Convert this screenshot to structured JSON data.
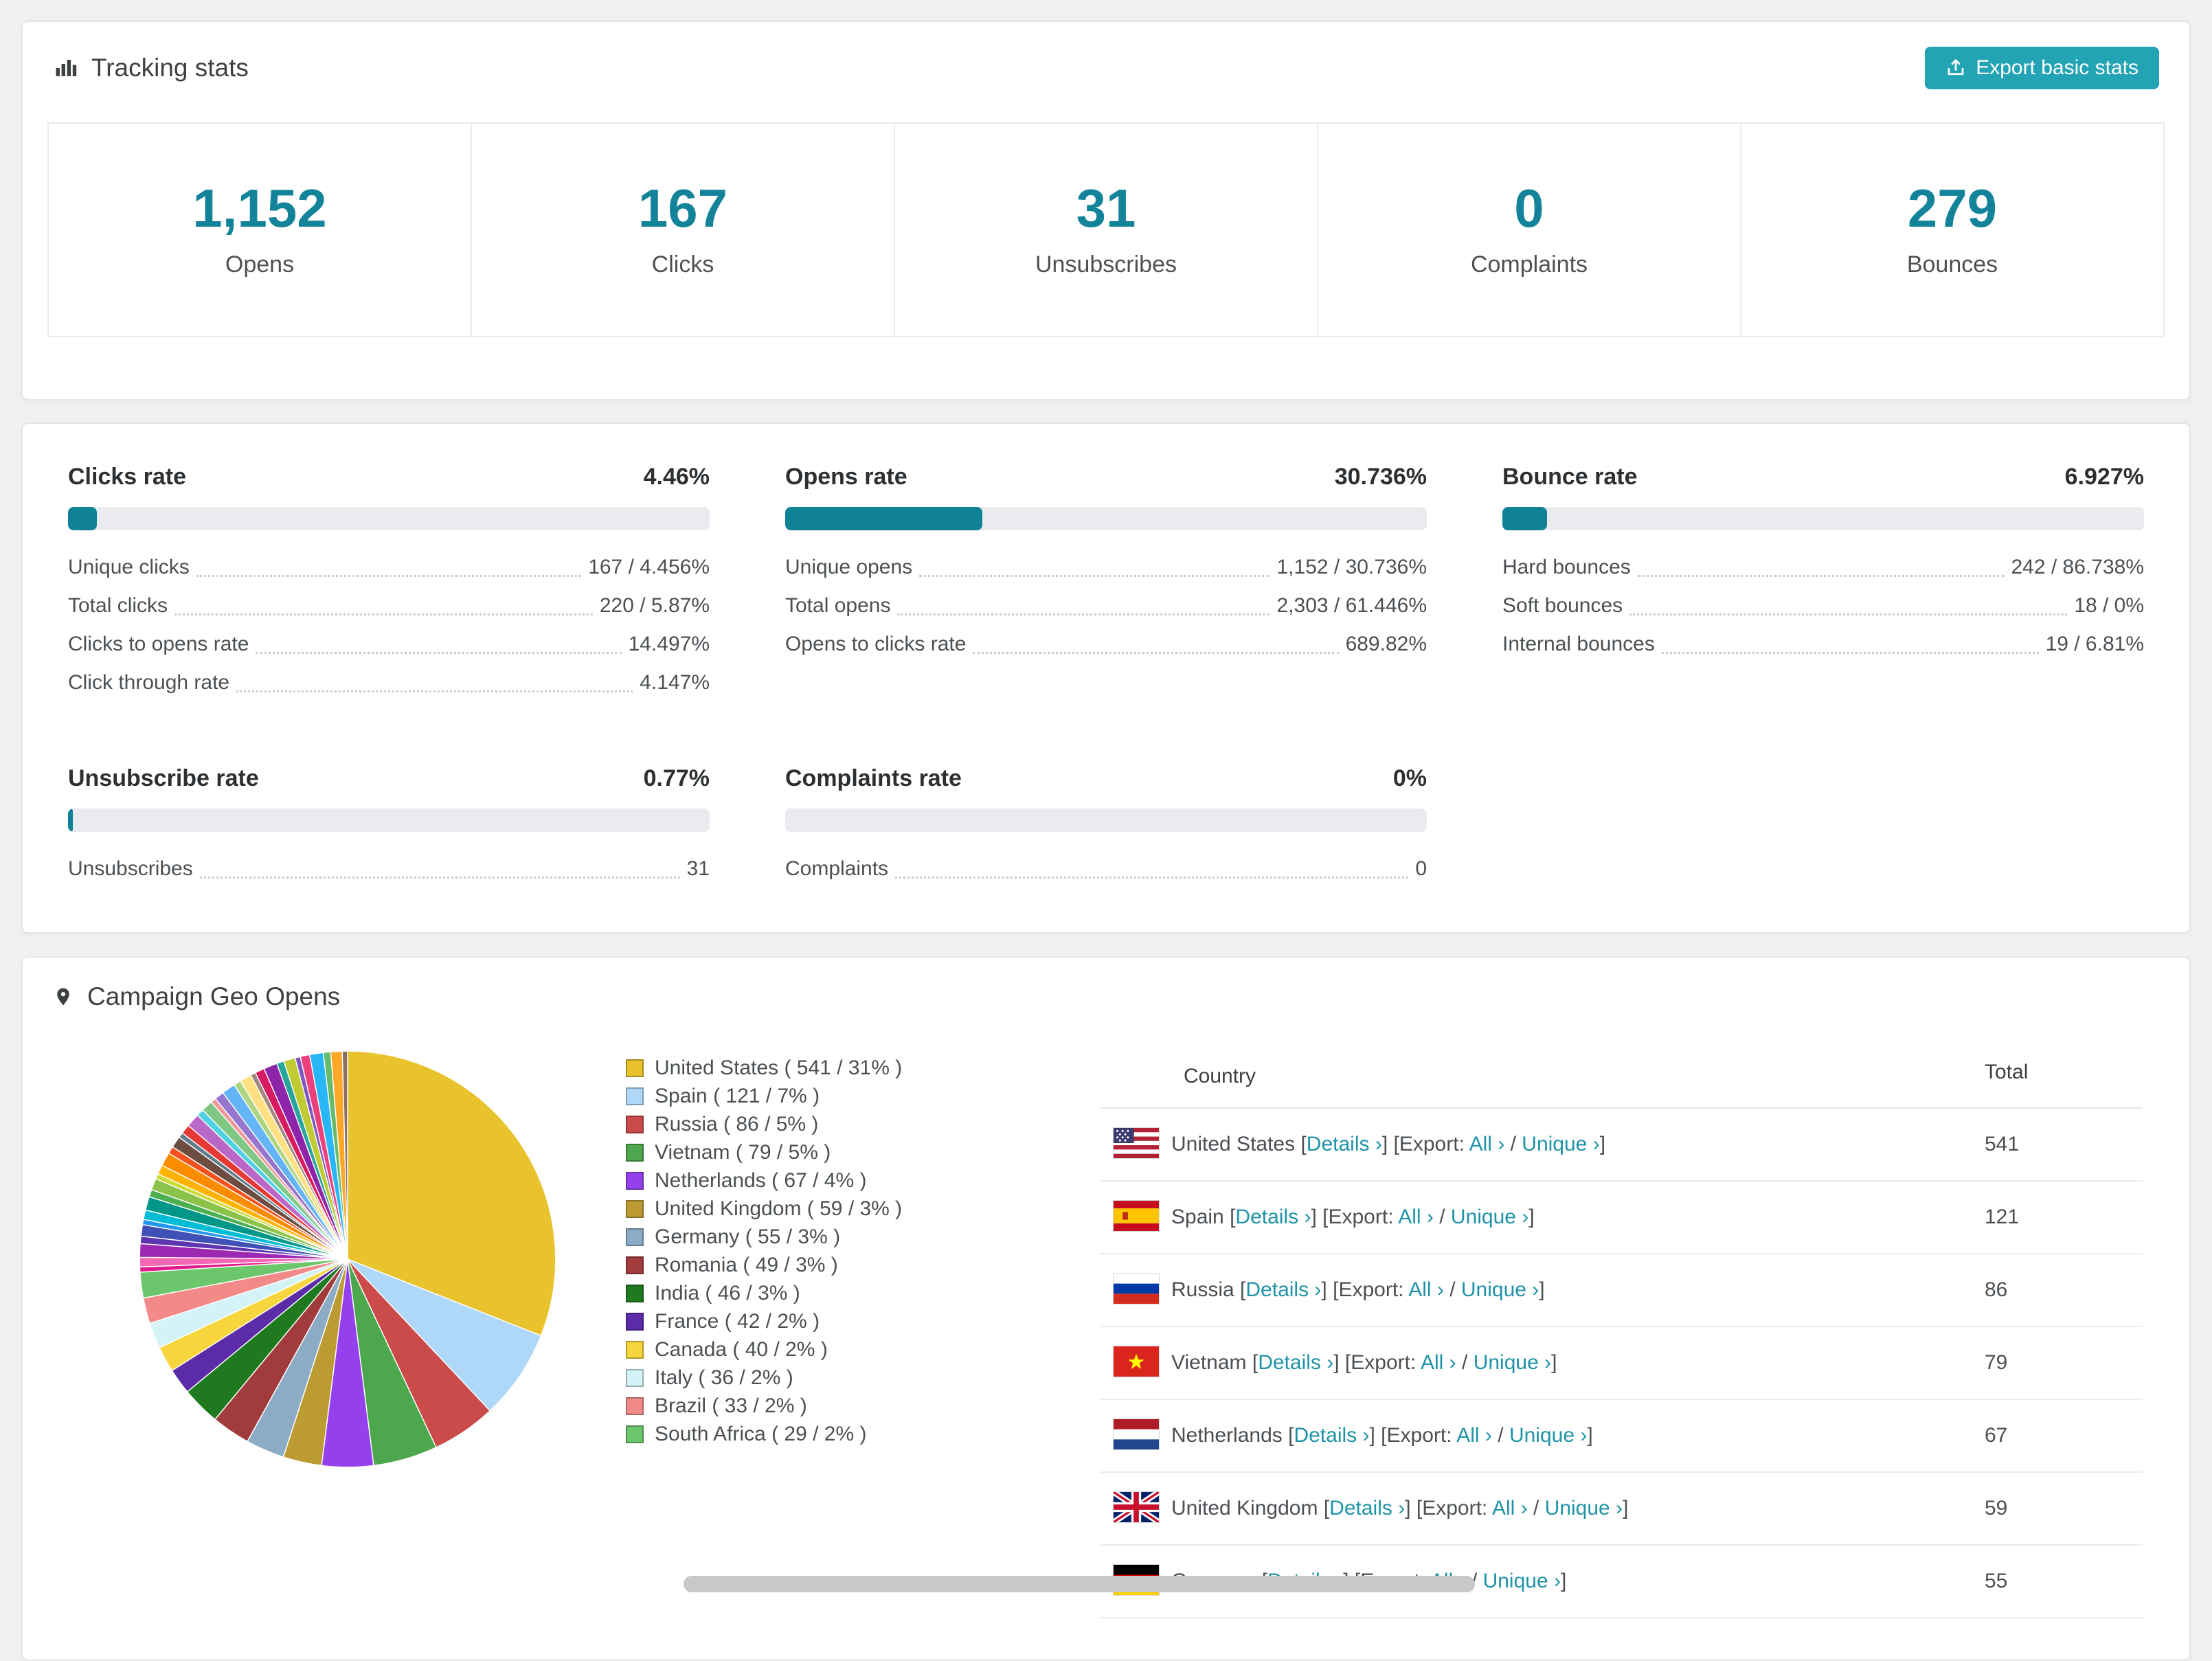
{
  "colors": {
    "accent": "#13839a",
    "button": "#23a4b4",
    "link": "#1f93a7",
    "progress_fill": "#0f8296",
    "progress_track": "#e9ebee"
  },
  "tracking": {
    "title": "Tracking stats",
    "export_button_label": "Export basic stats",
    "stats": [
      {
        "value": "1,152",
        "label": "Opens"
      },
      {
        "value": "167",
        "label": "Clicks"
      },
      {
        "value": "31",
        "label": "Unsubscribes"
      },
      {
        "value": "0",
        "label": "Complaints"
      },
      {
        "value": "279",
        "label": "Bounces"
      }
    ]
  },
  "rates": {
    "sections": [
      {
        "title": "Clicks rate",
        "value": "4.46%",
        "percent": 4.46,
        "rows": [
          {
            "label": "Unique clicks",
            "value": "167 / 4.456%"
          },
          {
            "label": "Total clicks",
            "value": "220 / 5.87%"
          },
          {
            "label": "Clicks to opens rate",
            "value": "14.497%"
          },
          {
            "label": "Click through rate",
            "value": "4.147%"
          }
        ]
      },
      {
        "title": "Opens rate",
        "value": "30.736%",
        "percent": 30.736,
        "rows": [
          {
            "label": "Unique opens",
            "value": "1,152 / 30.736%"
          },
          {
            "label": "Total opens",
            "value": "2,303 / 61.446%"
          },
          {
            "label": "Opens to clicks rate",
            "value": "689.82%"
          }
        ]
      },
      {
        "title": "Bounce rate",
        "value": "6.927%",
        "percent": 6.927,
        "rows": [
          {
            "label": "Hard bounces",
            "value": "242 / 86.738%"
          },
          {
            "label": "Soft bounces",
            "value": "18 / 0%"
          },
          {
            "label": "Internal bounces",
            "value": "19 / 6.81%"
          }
        ]
      },
      {
        "title": "Unsubscribe rate",
        "value": "0.77%",
        "percent": 0.77,
        "rows": [
          {
            "label": "Unsubscribes",
            "value": "31"
          }
        ]
      },
      {
        "title": "Complaints rate",
        "value": "0%",
        "percent": 0,
        "rows": [
          {
            "label": "Complaints",
            "value": "0"
          }
        ]
      }
    ]
  },
  "geo": {
    "title": "Campaign Geo Opens",
    "labels": {
      "open": "[",
      "close": "]",
      "details": "Details ›",
      "export": "Export:",
      "all": "All ›",
      "sep": "/",
      "unique": "Unique ›"
    },
    "table": {
      "country_header": "Country",
      "total_header": "Total",
      "rows": [
        {
          "country": "United States",
          "flag": "us",
          "total": "541"
        },
        {
          "country": "Spain",
          "flag": "es",
          "total": "121"
        },
        {
          "country": "Russia",
          "flag": "ru",
          "total": "86"
        },
        {
          "country": "Vietnam",
          "flag": "vn",
          "total": "79"
        },
        {
          "country": "Netherlands",
          "flag": "nl",
          "total": "67"
        },
        {
          "country": "United Kingdom",
          "flag": "gb",
          "total": "59"
        },
        {
          "country": "Germany",
          "flag": "de",
          "total": "55"
        }
      ]
    }
  },
  "chart_data": {
    "type": "pie",
    "title": "Campaign Geo Opens",
    "legend_position": "right",
    "slices": [
      {
        "label": "United States",
        "value": 541,
        "pct": 31,
        "color": "#e8c32e",
        "legend": "United States ( 541 / 31% )"
      },
      {
        "label": "Spain",
        "value": 121,
        "pct": 7,
        "color": "#afd8f8",
        "legend": "Spain ( 121 / 7% )"
      },
      {
        "label": "Russia",
        "value": 86,
        "pct": 5,
        "color": "#cb4b4b",
        "legend": "Russia ( 86 / 5% )"
      },
      {
        "label": "Vietnam",
        "value": 79,
        "pct": 5,
        "color": "#4da74d",
        "legend": "Vietnam ( 79 / 5% )"
      },
      {
        "label": "Netherlands",
        "value": 67,
        "pct": 4,
        "color": "#9440ed",
        "legend": "Netherlands ( 67 / 4% )"
      },
      {
        "label": "United Kingdom",
        "value": 59,
        "pct": 3,
        "color": "#bd9b33",
        "legend": "United Kingdom ( 59 / 3% )"
      },
      {
        "label": "Germany",
        "value": 55,
        "pct": 3,
        "color": "#8cacc6",
        "legend": "Germany ( 55 / 3% )"
      },
      {
        "label": "Romania",
        "value": 49,
        "pct": 3,
        "color": "#a23c3c",
        "legend": "Romania ( 49 / 3% )"
      },
      {
        "label": "India",
        "value": 46,
        "pct": 3,
        "color": "#1f7a1f",
        "legend": "India ( 46 / 3% )"
      },
      {
        "label": "France",
        "value": 42,
        "pct": 2,
        "color": "#5c2ba8",
        "legend": "France ( 42 / 2% )"
      },
      {
        "label": "Canada",
        "value": 40,
        "pct": 2,
        "color": "#f7d53c",
        "legend": "Canada ( 40 / 2% )"
      },
      {
        "label": "Italy",
        "value": 36,
        "pct": 2,
        "color": "#d3f3f7",
        "legend": "Italy ( 36 / 2% )"
      },
      {
        "label": "Brazil",
        "value": 33,
        "pct": 2,
        "color": "#f28a8a",
        "legend": "Brazil ( 33 / 2% )"
      },
      {
        "label": "South Africa",
        "value": 29,
        "pct": 2,
        "color": "#6cc66c",
        "legend": "South Africa ( 29 / 2% )"
      }
    ],
    "others_pct": 26,
    "filler_colors": [
      "#e01b8c",
      "#f468b5",
      "#9c27b0",
      "#5e35b1",
      "#3f51b5",
      "#2196f3",
      "#00bcd4",
      "#009688",
      "#4caf50",
      "#8bc34a",
      "#cddc39",
      "#ffb300",
      "#fb8c00",
      "#f4511e",
      "#6d4c41",
      "#607d8b",
      "#e53935",
      "#ba68c8",
      "#4dd0e1",
      "#81c784",
      "#ef9a9a",
      "#9575cd",
      "#64b5f6",
      "#aed581",
      "#ffe082",
      "#a1887f",
      "#d81b60",
      "#8e24aa",
      "#26a69a",
      "#c0ca33",
      "#7e57c2",
      "#ec407a",
      "#29b6f6",
      "#66bb6a",
      "#ffa726",
      "#8d6e63"
    ]
  }
}
